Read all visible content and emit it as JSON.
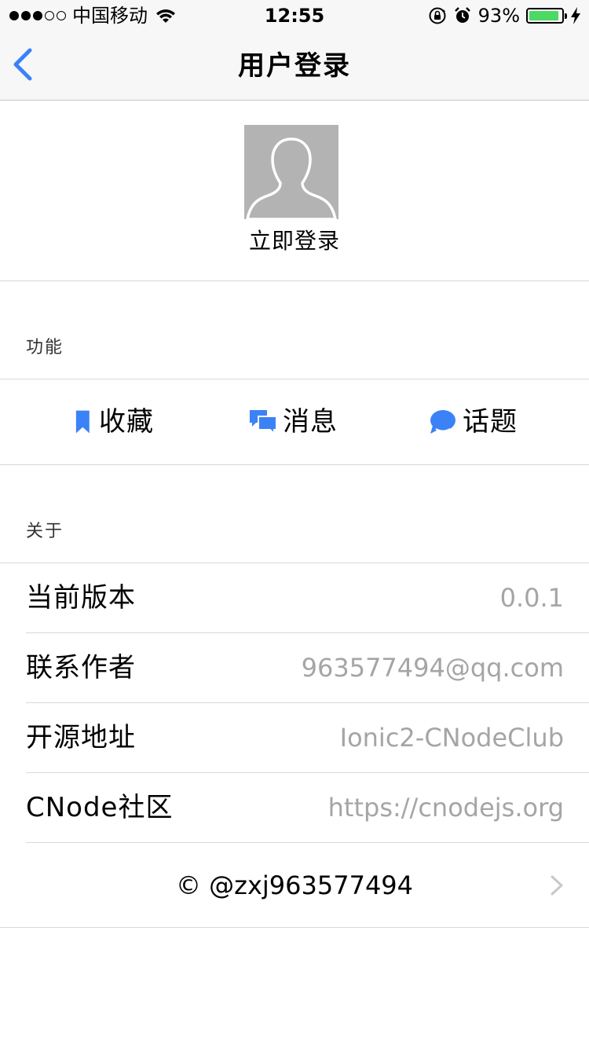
{
  "status_bar": {
    "carrier": "中国移动",
    "time": "12:55",
    "battery_percent": "93%",
    "battery_level": 0.93,
    "signal_bars_filled": 3,
    "signal_bars_total": 5,
    "icons": [
      "wifi-icon",
      "rotation-lock-icon",
      "alarm-icon",
      "battery-icon",
      "charging-bolt-icon"
    ]
  },
  "nav": {
    "title": "用户登录",
    "back_icon": "chevron-left-icon"
  },
  "profile": {
    "login_label": "立即登录",
    "avatar_icon": "default-avatar-icon"
  },
  "sections": {
    "features_header": "功能",
    "about_header": "关于"
  },
  "features": [
    {
      "label": "收藏",
      "icon": "bookmark-icon"
    },
    {
      "label": "消息",
      "icon": "chat-bubbles-icon"
    },
    {
      "label": "话题",
      "icon": "speech-bubble-icon"
    }
  ],
  "about": [
    {
      "label": "当前版本",
      "value": "0.0.1"
    },
    {
      "label": "联系作者",
      "value": "963577494@qq.com"
    },
    {
      "label": "开源地址",
      "value": "Ionic2-CNodeClub"
    },
    {
      "label": "CNode社区",
      "value": "https://cnodejs.org"
    }
  ],
  "copyright": {
    "text": "© @zxj963577494",
    "icon": "chevron-right-icon"
  },
  "colors": {
    "accent": "#3b82f6",
    "muted_text": "#a5a5a5",
    "battery_green": "#4cd964",
    "avatar_bg": "#b3b3b3",
    "bar_bg": "#f7f7f7"
  }
}
